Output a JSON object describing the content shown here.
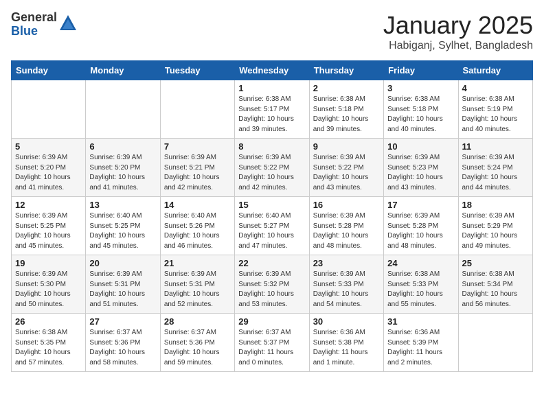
{
  "logo": {
    "general": "General",
    "blue": "Blue"
  },
  "title": "January 2025",
  "subtitle": "Habiganj, Sylhet, Bangladesh",
  "headers": [
    "Sunday",
    "Monday",
    "Tuesday",
    "Wednesday",
    "Thursday",
    "Friday",
    "Saturday"
  ],
  "weeks": [
    [
      {
        "day": "",
        "info": ""
      },
      {
        "day": "",
        "info": ""
      },
      {
        "day": "",
        "info": ""
      },
      {
        "day": "1",
        "info": "Sunrise: 6:38 AM\nSunset: 5:17 PM\nDaylight: 10 hours\nand 39 minutes."
      },
      {
        "day": "2",
        "info": "Sunrise: 6:38 AM\nSunset: 5:18 PM\nDaylight: 10 hours\nand 39 minutes."
      },
      {
        "day": "3",
        "info": "Sunrise: 6:38 AM\nSunset: 5:18 PM\nDaylight: 10 hours\nand 40 minutes."
      },
      {
        "day": "4",
        "info": "Sunrise: 6:38 AM\nSunset: 5:19 PM\nDaylight: 10 hours\nand 40 minutes."
      }
    ],
    [
      {
        "day": "5",
        "info": "Sunrise: 6:39 AM\nSunset: 5:20 PM\nDaylight: 10 hours\nand 41 minutes."
      },
      {
        "day": "6",
        "info": "Sunrise: 6:39 AM\nSunset: 5:20 PM\nDaylight: 10 hours\nand 41 minutes."
      },
      {
        "day": "7",
        "info": "Sunrise: 6:39 AM\nSunset: 5:21 PM\nDaylight: 10 hours\nand 42 minutes."
      },
      {
        "day": "8",
        "info": "Sunrise: 6:39 AM\nSunset: 5:22 PM\nDaylight: 10 hours\nand 42 minutes."
      },
      {
        "day": "9",
        "info": "Sunrise: 6:39 AM\nSunset: 5:22 PM\nDaylight: 10 hours\nand 43 minutes."
      },
      {
        "day": "10",
        "info": "Sunrise: 6:39 AM\nSunset: 5:23 PM\nDaylight: 10 hours\nand 43 minutes."
      },
      {
        "day": "11",
        "info": "Sunrise: 6:39 AM\nSunset: 5:24 PM\nDaylight: 10 hours\nand 44 minutes."
      }
    ],
    [
      {
        "day": "12",
        "info": "Sunrise: 6:39 AM\nSunset: 5:25 PM\nDaylight: 10 hours\nand 45 minutes."
      },
      {
        "day": "13",
        "info": "Sunrise: 6:40 AM\nSunset: 5:25 PM\nDaylight: 10 hours\nand 45 minutes."
      },
      {
        "day": "14",
        "info": "Sunrise: 6:40 AM\nSunset: 5:26 PM\nDaylight: 10 hours\nand 46 minutes."
      },
      {
        "day": "15",
        "info": "Sunrise: 6:40 AM\nSunset: 5:27 PM\nDaylight: 10 hours\nand 47 minutes."
      },
      {
        "day": "16",
        "info": "Sunrise: 6:39 AM\nSunset: 5:28 PM\nDaylight: 10 hours\nand 48 minutes."
      },
      {
        "day": "17",
        "info": "Sunrise: 6:39 AM\nSunset: 5:28 PM\nDaylight: 10 hours\nand 48 minutes."
      },
      {
        "day": "18",
        "info": "Sunrise: 6:39 AM\nSunset: 5:29 PM\nDaylight: 10 hours\nand 49 minutes."
      }
    ],
    [
      {
        "day": "19",
        "info": "Sunrise: 6:39 AM\nSunset: 5:30 PM\nDaylight: 10 hours\nand 50 minutes."
      },
      {
        "day": "20",
        "info": "Sunrise: 6:39 AM\nSunset: 5:31 PM\nDaylight: 10 hours\nand 51 minutes."
      },
      {
        "day": "21",
        "info": "Sunrise: 6:39 AM\nSunset: 5:31 PM\nDaylight: 10 hours\nand 52 minutes."
      },
      {
        "day": "22",
        "info": "Sunrise: 6:39 AM\nSunset: 5:32 PM\nDaylight: 10 hours\nand 53 minutes."
      },
      {
        "day": "23",
        "info": "Sunrise: 6:39 AM\nSunset: 5:33 PM\nDaylight: 10 hours\nand 54 minutes."
      },
      {
        "day": "24",
        "info": "Sunrise: 6:38 AM\nSunset: 5:33 PM\nDaylight: 10 hours\nand 55 minutes."
      },
      {
        "day": "25",
        "info": "Sunrise: 6:38 AM\nSunset: 5:34 PM\nDaylight: 10 hours\nand 56 minutes."
      }
    ],
    [
      {
        "day": "26",
        "info": "Sunrise: 6:38 AM\nSunset: 5:35 PM\nDaylight: 10 hours\nand 57 minutes."
      },
      {
        "day": "27",
        "info": "Sunrise: 6:37 AM\nSunset: 5:36 PM\nDaylight: 10 hours\nand 58 minutes."
      },
      {
        "day": "28",
        "info": "Sunrise: 6:37 AM\nSunset: 5:36 PM\nDaylight: 10 hours\nand 59 minutes."
      },
      {
        "day": "29",
        "info": "Sunrise: 6:37 AM\nSunset: 5:37 PM\nDaylight: 11 hours\nand 0 minutes."
      },
      {
        "day": "30",
        "info": "Sunrise: 6:36 AM\nSunset: 5:38 PM\nDaylight: 11 hours\nand 1 minute."
      },
      {
        "day": "31",
        "info": "Sunrise: 6:36 AM\nSunset: 5:39 PM\nDaylight: 11 hours\nand 2 minutes."
      },
      {
        "day": "",
        "info": ""
      }
    ]
  ]
}
